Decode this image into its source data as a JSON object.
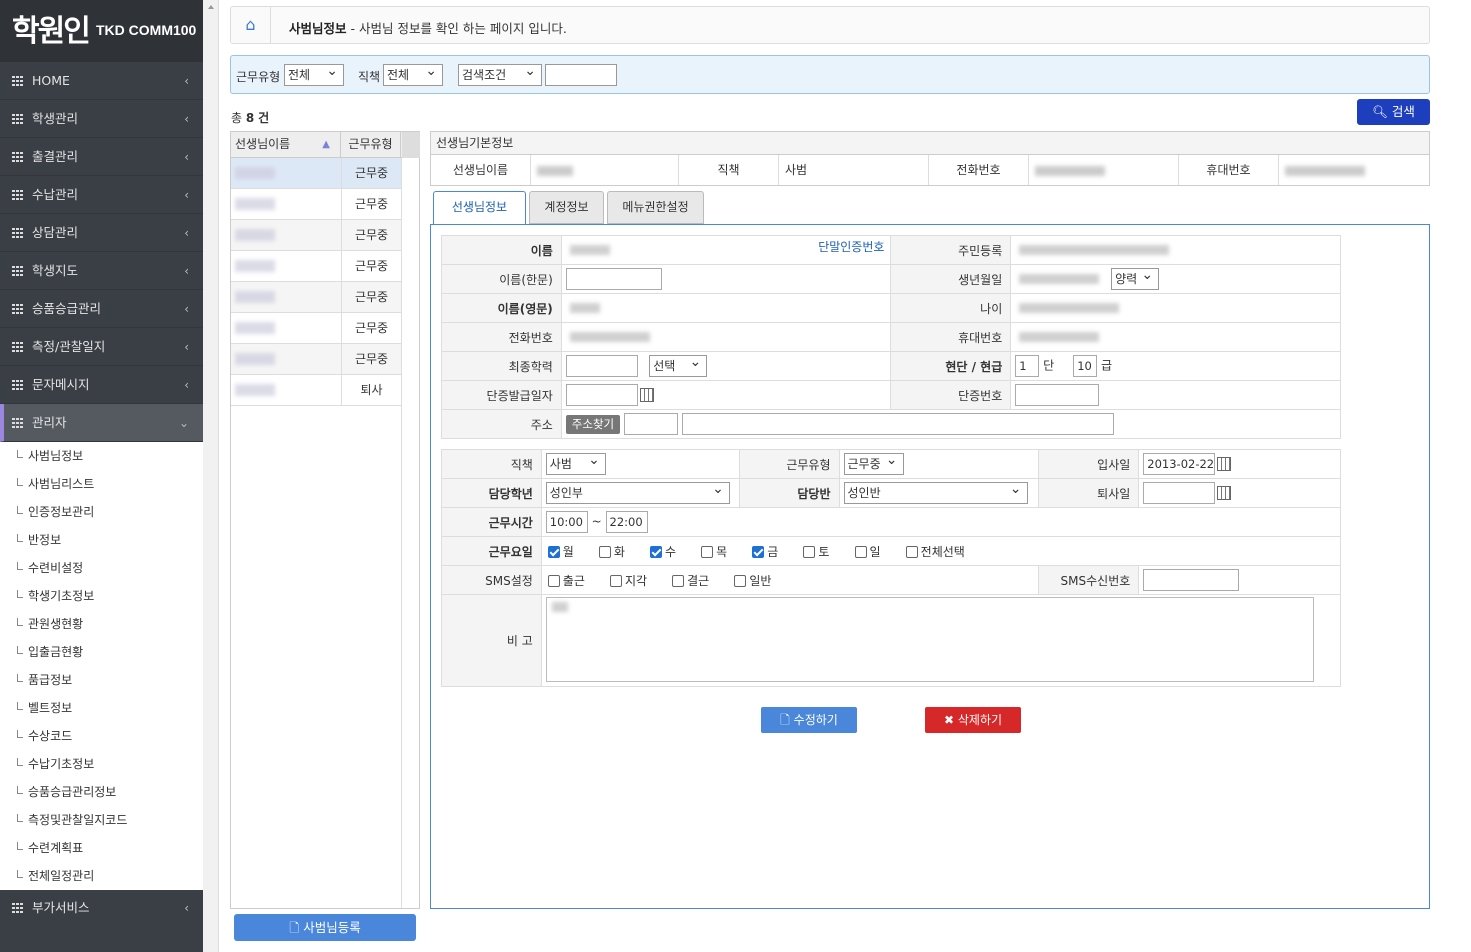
{
  "logo": {
    "mark": "학원인",
    "text": "TKD COMM100"
  },
  "menu": {
    "items": [
      {
        "label": "HOME"
      },
      {
        "label": "학생관리"
      },
      {
        "label": "출결관리"
      },
      {
        "label": "수납관리"
      },
      {
        "label": "상담관리"
      },
      {
        "label": "학생지도"
      },
      {
        "label": "승품승급관리"
      },
      {
        "label": "측정/관찰일지"
      },
      {
        "label": "문자메시지"
      },
      {
        "label": "관리자"
      }
    ],
    "sub": [
      "사범님정보",
      "사범님리스트",
      "인증정보관리",
      "반정보",
      "수련비설정",
      "학생기초정보",
      "관원생현황",
      "입출금현황",
      "품급정보",
      "벨트정보",
      "수상코드",
      "수납기초정보",
      "승품승급관리정보",
      "측정및관찰일지코드",
      "수련계획표",
      "전체일정관리"
    ],
    "bottom": "부가서비스"
  },
  "breadcrumb": {
    "title": "사범님정보",
    "desc": " - 사범님 정보를 확인 하는 페이지 입니다."
  },
  "filter": {
    "work_type_label": "근무유형",
    "work_type_value": "전체",
    "position_label": "직책",
    "position_value": "전체",
    "cond_value": "검색조건",
    "keyword": ""
  },
  "search_button": "검색",
  "count": {
    "prefix": "총",
    "num": "8",
    "suffix": "건"
  },
  "list": {
    "headers": [
      "선생님이름",
      "근무유형"
    ],
    "rows": [
      {
        "status": "근무중"
      },
      {
        "status": "근무중"
      },
      {
        "status": "근무중"
      },
      {
        "status": "근무중"
      },
      {
        "status": "근무중"
      },
      {
        "status": "근무중"
      },
      {
        "status": "근무중"
      },
      {
        "status": "퇴사"
      }
    ]
  },
  "register_button": "사범님등록",
  "info": {
    "title": "선생님기본정보",
    "name_label": "선생님이름",
    "position_label": "직책",
    "position_value": "사범",
    "phone_label": "전화번호",
    "mobile_label": "휴대번호"
  },
  "tabs": [
    "선생님정보",
    "계정정보",
    "메뉴권한설정"
  ],
  "form": {
    "name": "이름",
    "auth_link": "단말인증번호",
    "resident": "주민등록",
    "name_hanja": "이름(한문)",
    "birth": "생년월일",
    "calendar": "양력",
    "name_en": "이름(영문)",
    "age": "나이",
    "phone": "전화번호",
    "mobile": "휴대번호",
    "education": "최종학력",
    "education_select": "선택",
    "dan": "현단 / 현급",
    "dan_value": "1",
    "dan_unit": "단",
    "gup_value": "10",
    "gup_unit": "급",
    "dan_issue": "단증발급일자",
    "dan_no": "단증번호",
    "address": "주소",
    "address_btn": "주소찾기",
    "position": "직책",
    "position_value": "사범",
    "work_type": "근무유형",
    "work_type_value": "근무중",
    "join_date": "입사일",
    "join_date_value": "2013-02-22",
    "grade": "담당학년",
    "grade_value": "성인부",
    "class": "담당반",
    "class_value": "성인반",
    "leave_date": "퇴사일",
    "work_time": "근무시간",
    "time_from": "10:00",
    "time_sep": "~",
    "time_to": "22:00",
    "work_days": "근무요일",
    "days": [
      {
        "label": "월",
        "on": true
      },
      {
        "label": "화",
        "on": false
      },
      {
        "label": "수",
        "on": true
      },
      {
        "label": "목",
        "on": false
      },
      {
        "label": "금",
        "on": true
      },
      {
        "label": "토",
        "on": false
      },
      {
        "label": "일",
        "on": false
      },
      {
        "label": "전체선택",
        "on": false
      }
    ],
    "sms": "SMS설정",
    "sms_opts": [
      "출근",
      "지각",
      "결근",
      "일반"
    ],
    "sms_no": "SMS수신번호",
    "note": "비 고"
  },
  "edit_button": "수정하기",
  "delete_button": "삭제하기"
}
